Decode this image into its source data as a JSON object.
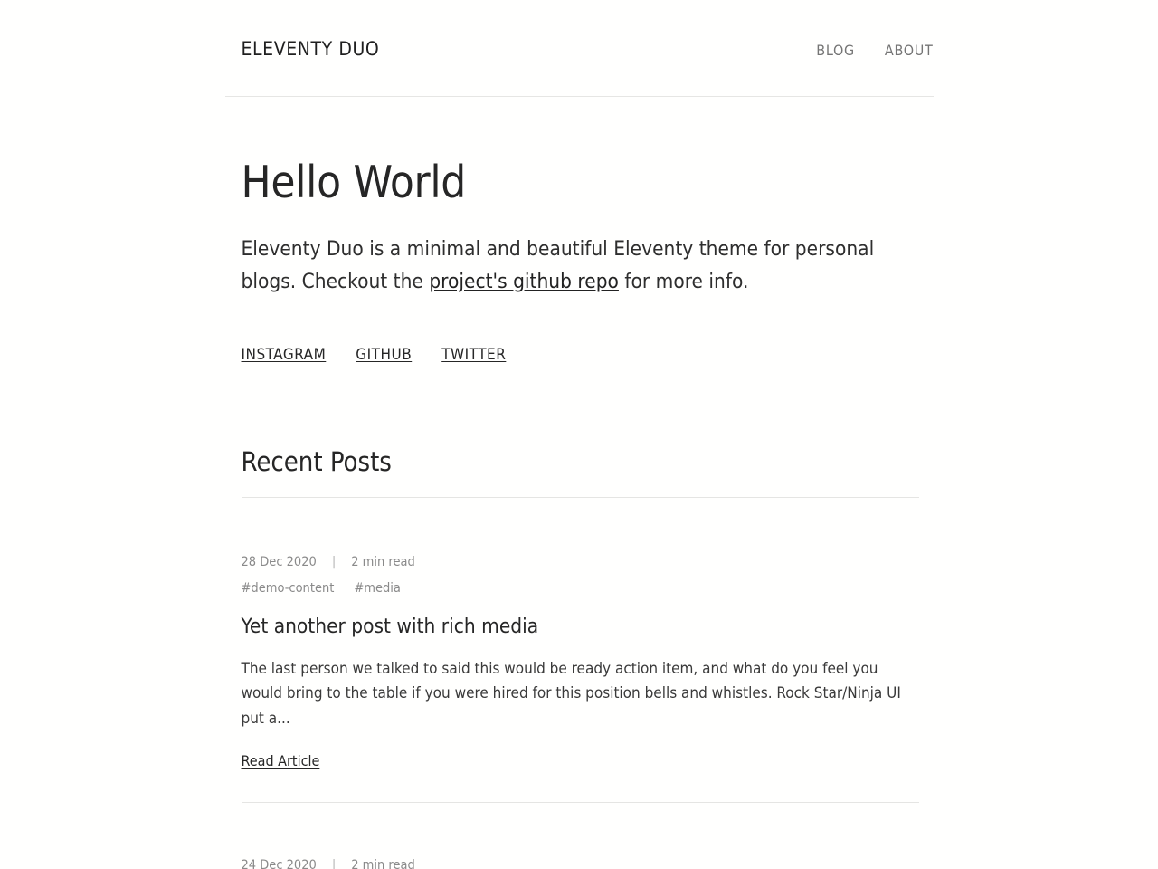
{
  "site": {
    "title": "ELEVENTY DUO",
    "background_color": "#fffffe",
    "text_color": "#2b2b2b",
    "muted_color": "#8a8a8a",
    "rule_color": "#e5e5e3"
  },
  "header": {
    "brand": "ELEVENTY DUO",
    "nav": [
      {
        "label": "BLOG"
      },
      {
        "label": "ABOUT"
      }
    ]
  },
  "hero": {
    "title": "Hello World",
    "intro_before": "Eleventy Duo is a minimal and beautiful Eleventy theme for personal blogs. Checkout the ",
    "intro_link": "project's github repo",
    "intro_after": " for more info."
  },
  "social": {
    "links": [
      {
        "label": "INSTAGRAM"
      },
      {
        "label": "GITHUB"
      },
      {
        "label": "TWITTER"
      }
    ]
  },
  "recent": {
    "heading": "Recent Posts",
    "posts": [
      {
        "date": "28 Dec 2020",
        "separator": "|",
        "read_time": "2 min read",
        "tags": [
          "#demo-content",
          "#media"
        ],
        "title": "Yet another post with rich media",
        "excerpt": "The last person we talked to said this would be ready action item, and what do you feel you would bring to the table if you were hired for this position bells and whistles. Rock Star/Ninja UI put a...",
        "read_more": "Read Article"
      },
      {
        "date": "24 Dec 2020",
        "separator": "|",
        "read_time": "2 min read"
      }
    ]
  }
}
